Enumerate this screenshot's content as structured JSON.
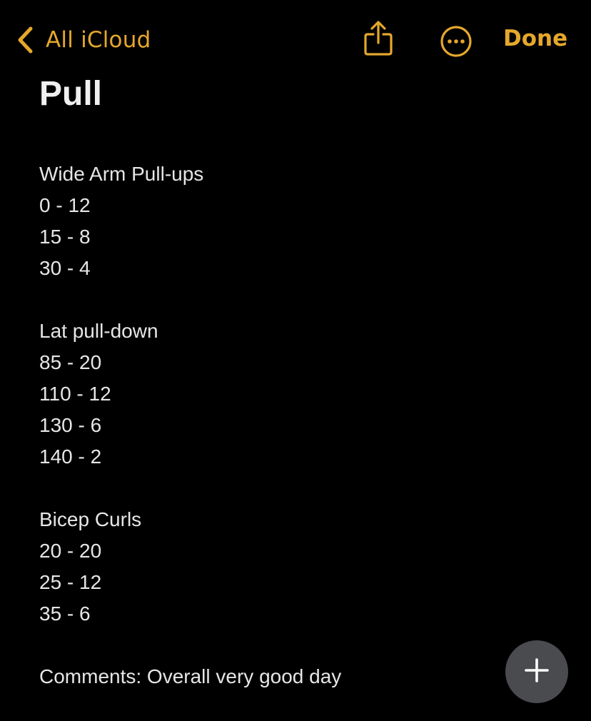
{
  "nav": {
    "back_label": "All iCloud",
    "done_label": "Done"
  },
  "icons": {
    "back": "chevron-left-icon",
    "share": "share-icon",
    "more": "ellipsis-circle-icon",
    "add": "plus-icon"
  },
  "colors": {
    "accent": "#e5a82c",
    "background": "#000000",
    "text": "#e6e6e6",
    "fab": "#4a4b4f"
  },
  "note": {
    "title": "Pull",
    "lines": [
      "Wide Arm Pull-ups",
      "0 - 12",
      "15 - 8",
      "30 - 4",
      "",
      "Lat pull-down",
      "85 - 20",
      "110 - 12",
      "130 - 6",
      "140 - 2",
      "",
      "Bicep Curls",
      "20 - 20",
      "25 - 12",
      "35 - 6",
      "",
      "Comments: Overall very good day"
    ]
  }
}
